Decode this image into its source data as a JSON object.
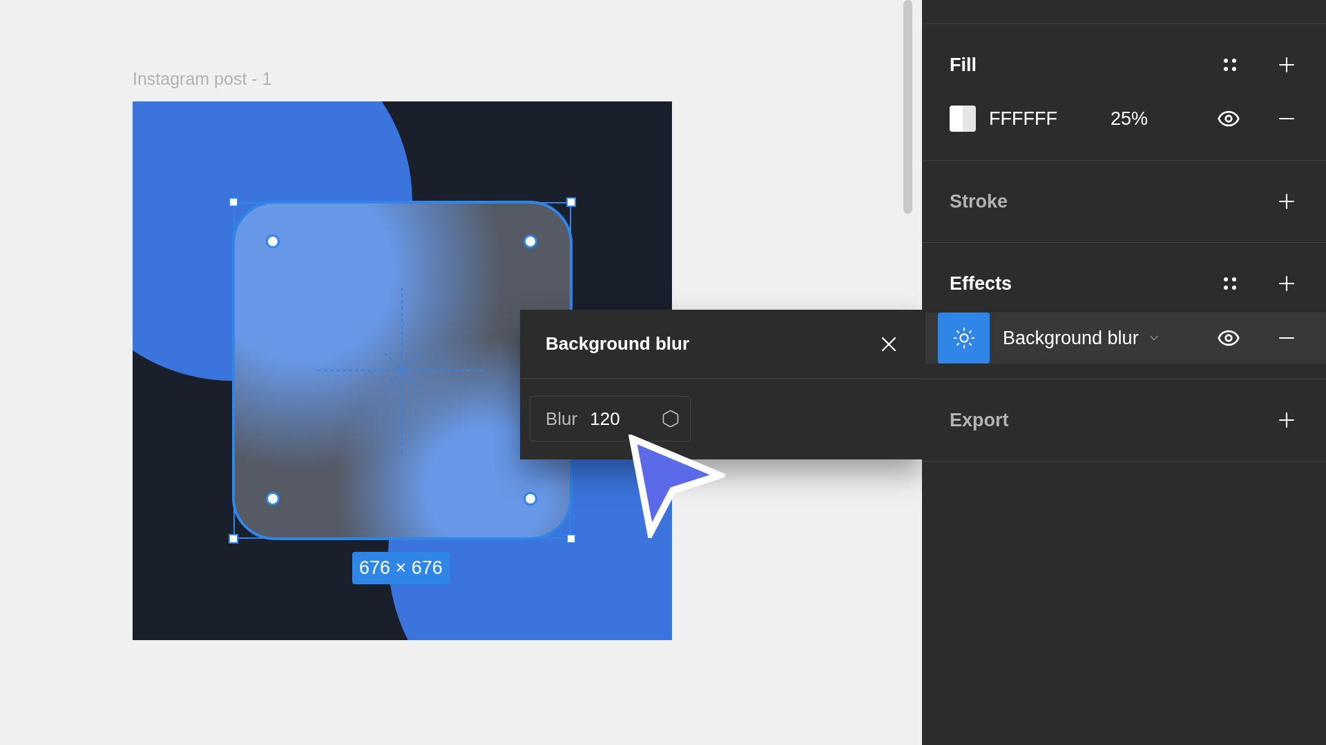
{
  "canvas": {
    "frame_label": "Instagram post - 1",
    "selection": {
      "dimensions": "676 × 676"
    }
  },
  "blur_popup": {
    "title": "Background blur",
    "field": {
      "label": "Blur",
      "value": "120"
    }
  },
  "panel": {
    "sections": [
      {
        "kind": "fill",
        "title": "Fill",
        "active": true,
        "items": [
          {
            "hex": "FFFFFF",
            "opacity": "25%",
            "visible": true
          }
        ]
      },
      {
        "kind": "stroke",
        "title": "Stroke",
        "active": false
      },
      {
        "kind": "effects",
        "title": "Effects",
        "active": true,
        "items": [
          {
            "name": "Background blur",
            "visible": true,
            "selected": true
          }
        ]
      },
      {
        "kind": "export",
        "title": "Export",
        "active": false
      }
    ]
  }
}
